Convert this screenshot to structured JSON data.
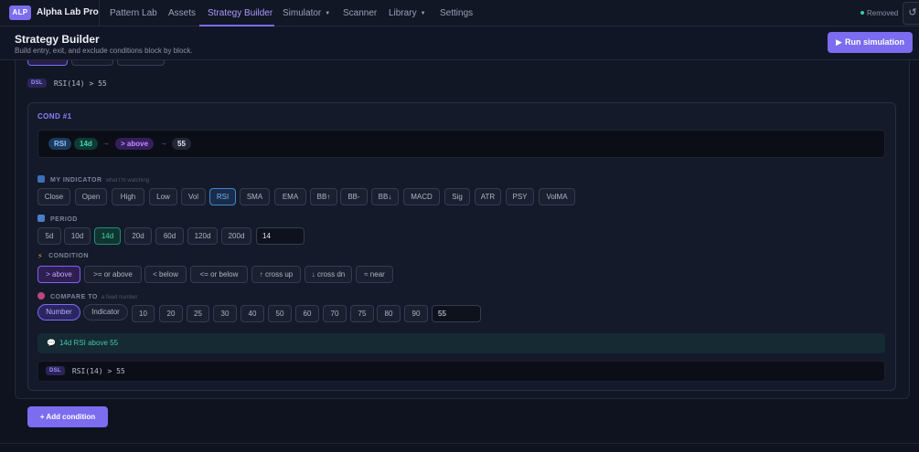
{
  "nav": {
    "logo": "ALP",
    "app_title": "Alpha Lab Pro",
    "items": [
      {
        "label": "Pattern Lab",
        "dropdown": false,
        "active": false
      },
      {
        "label": "Assets",
        "dropdown": false,
        "active": false
      },
      {
        "label": "Strategy Builder",
        "dropdown": false,
        "active": true
      },
      {
        "label": "Simulator",
        "dropdown": true,
        "active": false
      },
      {
        "label": "Scanner",
        "dropdown": false,
        "active": false
      },
      {
        "label": "Library",
        "dropdown": true,
        "active": false
      },
      {
        "label": "Settings",
        "dropdown": false,
        "active": false
      }
    ],
    "status": "Removed",
    "status_color": "#2fd39c",
    "refresh_icon": "refresh-icon",
    "refresh_glyph": "↺"
  },
  "header": {
    "title": "Strategy Builder",
    "subtitle": "Build entry, exit, and exclude conditions block by block.",
    "run_button": "Run simulation",
    "run_icon": "play-icon",
    "run_glyph": "▶"
  },
  "previous_block": {
    "dsl_badge": "DSL",
    "dsl_text": "RSI(14) > 55"
  },
  "condition": {
    "title": "COND #1",
    "summary": {
      "indicator": "RSI",
      "period": "14d",
      "condition": "> above",
      "value": "55",
      "arrow": "→"
    },
    "my_indicator": {
      "label": "MY INDICATOR",
      "hint": "what I'm watching",
      "icon": "chart-icon",
      "options": [
        "Close",
        "Open",
        "High",
        "Low",
        "Vol",
        "RSI",
        "SMA",
        "EMA",
        "BB↑",
        "BB-",
        "BB↓",
        "MACD",
        "Sig",
        "ATR",
        "PSY",
        "VolMA"
      ],
      "selected": "RSI"
    },
    "period": {
      "label": "PERIOD",
      "icon": "calendar-icon",
      "options": [
        "5d",
        "10d",
        "14d",
        "20d",
        "60d",
        "120d",
        "200d"
      ],
      "selected": "14d",
      "input_value": "14"
    },
    "cond": {
      "label": "CONDITION",
      "icon": "lightning-icon",
      "options": [
        "> above",
        ">= or above",
        "< below",
        "<= or below",
        "↑ cross up",
        "↓ cross dn",
        "≈ near"
      ],
      "selected": "> above"
    },
    "compare_to": {
      "label": "COMPARE TO",
      "hint": "a fixed number",
      "icon": "target-icon",
      "modes": [
        "Number",
        "Indicator"
      ],
      "selected_mode": "Number",
      "options": [
        "10",
        "20",
        "25",
        "30",
        "40",
        "50",
        "60",
        "70",
        "75",
        "80",
        "90"
      ],
      "input_value": "55"
    },
    "description": "14d RSI above 55",
    "description_icon": "speech-bubble-icon",
    "description_glyph": "💬",
    "dsl_badge": "DSL",
    "dsl_text": "RSI(14) > 55"
  },
  "add_condition_label": "+ Add condition"
}
